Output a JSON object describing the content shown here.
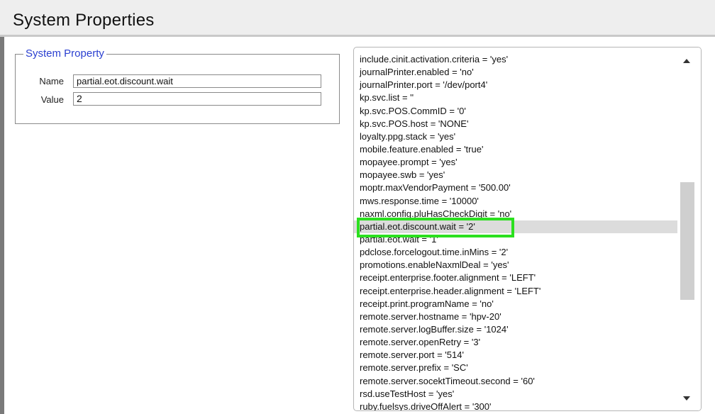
{
  "header": {
    "title": "System Properties"
  },
  "system_property": {
    "legend": "System Property",
    "name_label": "Name",
    "name_value": "partial.eot.discount.wait",
    "value_label": "Value",
    "value_value": "2"
  },
  "property_list": {
    "items": [
      "include.cinit.activation.criteria = 'yes'",
      "journalPrinter.enabled = 'no'",
      "journalPrinter.port = '/dev/port4'",
      "kp.svc.list = ''",
      "kp.svc.POS.CommID = '0'",
      "kp.svc.POS.host = 'NONE'",
      "loyalty.ppg.stack = 'yes'",
      "mobile.feature.enabled = 'true'",
      "mopayee.prompt = 'yes'",
      "mopayee.swb = 'yes'",
      "moptr.maxVendorPayment = '500.00'",
      "mws.response.time = '10000'",
      "naxml.config.pluHasCheckDigit = 'no'",
      "partial.eot.discount.wait = '2'",
      "partial.eot.wait = '1'",
      "pdclose.forcelogout.time.inMins = '2'",
      "promotions.enableNaxmlDeal = 'yes'",
      "receipt.enterprise.footer.alignment = 'LEFT'",
      "receipt.enterprise.header.alignment = 'LEFT'",
      "receipt.print.programName = 'no'",
      "remote.server.hostname = 'hpv-20'",
      "remote.server.logBuffer.size = '1024'",
      "remote.server.openRetry = '3'",
      "remote.server.port = '514'",
      "remote.server.prefix = 'SC'",
      "remote.server.socektTimeout.second = '60'",
      "rsd.useTestHost = 'yes'",
      "ruby.fuelsys.driveOffAlert = '300'"
    ],
    "selected_index": 13,
    "scrollbar": {
      "up_icon": "arrow-up-icon",
      "down_icon": "arrow-down-icon"
    }
  },
  "colors": {
    "legend": "#2a3fd0",
    "highlight": "#2be01f",
    "selected_row": "#dcdcdc",
    "header_bg": "#eeeeee"
  }
}
